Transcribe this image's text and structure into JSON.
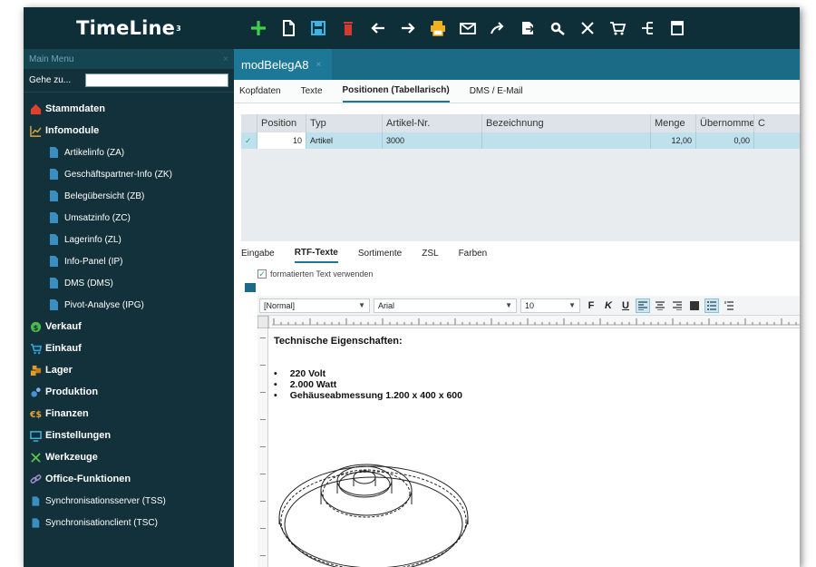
{
  "app": {
    "name": "TimeLine",
    "superscript": "3"
  },
  "toolbar": {
    "icons": [
      "plus-icon",
      "new-document-icon",
      "save-icon",
      "delete-icon",
      "arrow-left-icon",
      "arrow-right-icon",
      "print-icon",
      "mail-icon",
      "forward-icon",
      "export-icon",
      "settings-icon",
      "close-icon",
      "cart-icon",
      "tree-icon",
      "window-icon"
    ]
  },
  "sidebar": {
    "header": "Main Menu",
    "close_glyph": "×",
    "goto_label": "Gehe zu...",
    "goto_value": "",
    "groups": [
      {
        "label": "Stammdaten",
        "icon": "house-icon",
        "color": "#e0412c"
      },
      {
        "label": "Infomodule",
        "icon": "chart-icon",
        "color": "#d9a43a",
        "items": [
          "Artikelinfo (ZA)",
          "Geschäftspartner-Info (ZK)",
          "Belegübersicht (ZB)",
          "Umsatzinfo (ZC)",
          "Lagerinfo (ZL)",
          "Info-Panel (IP)",
          "DMS (DMS)",
          "Pivot-Analyse (IPG)"
        ]
      },
      {
        "label": "Verkauf",
        "icon": "dollar-icon",
        "color": "#4cb84c"
      },
      {
        "label": "Einkauf",
        "icon": "cart-icon",
        "color": "#2f9fd8"
      },
      {
        "label": "Lager",
        "icon": "boxes-icon",
        "color": "#e39b2c"
      },
      {
        "label": "Produktion",
        "icon": "gears-icon",
        "color": "#4a8fd8"
      },
      {
        "label": "Finanzen",
        "icon": "money-icon",
        "color": "#e8a22a"
      },
      {
        "label": "Einstellungen",
        "icon": "monitor-icon",
        "color": "#3fb1d8"
      },
      {
        "label": "Werkzeuge",
        "icon": "tools-icon",
        "color": "#59c04a"
      },
      {
        "label": "Office-Funktionen",
        "icon": "link-icon",
        "color": "#9b8fd0"
      },
      {
        "label": "Synchronisationsserver (TSS)",
        "icon": "document-icon",
        "color": "#3a8ec0"
      },
      {
        "label": "Synchronisationclient (TSC)",
        "icon": "document-icon",
        "color": "#3a8ec0"
      }
    ]
  },
  "document_tab": {
    "title": "modBelegA8",
    "close_glyph": "×"
  },
  "detail_tabs": [
    "Kopfdaten",
    "Texte",
    "Positionen (Tabellarisch)",
    "DMS / E-Mail"
  ],
  "grid": {
    "columns": [
      "Position",
      "Typ",
      "Artikel-Nr.",
      "Bezeichnung",
      "Menge",
      "Übernommen",
      "C"
    ],
    "row": {
      "mark": "✓",
      "position": "10",
      "typ": "Artikel",
      "artikel_nr": "3000",
      "bezeichnung": "",
      "menge": "12,00",
      "uebernommen": "0,00"
    }
  },
  "lower_tabs": [
    "Eingabe",
    "RTF-Texte",
    "Sortimente",
    "ZSL",
    "Farben"
  ],
  "rtf": {
    "checkbox_label": "formatierten Text verwenden",
    "checkbox_mark": "✓",
    "style_value": "[Normal]",
    "font_value": "Arial",
    "size_value": "10",
    "bold": "F",
    "italic": "K",
    "underline": "U",
    "heading": "Technische Eigenschaften:",
    "bullets": [
      "220 Volt",
      "2.000 Watt",
      "Gehäuseabmessung 1.200 x 400 x 600"
    ]
  }
}
